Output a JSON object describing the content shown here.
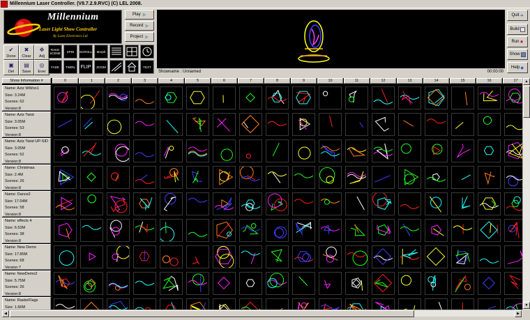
{
  "window": {
    "title": "Millennium Laser Controller. (V8.7.2.9.RVC) (C) LEL 2008."
  },
  "logo": {
    "brand": "Millennium",
    "subtitle": "Laser Light Show Controller",
    "byline": "By Laser Electronics Ltd"
  },
  "transport": {
    "play": "Play",
    "record": "Record",
    "project": "Project"
  },
  "tools": {
    "done": "Done",
    "clear": "Clear",
    "adj": "Adj",
    "del": "Del",
    "save": "Save",
    "ever": "Ever"
  },
  "effects": {
    "rake_scene": "RAKE SCENE",
    "spin": "SPIN",
    "scroll": "SCROLL",
    "morph": "Morph",
    "fade": "FADE",
    "twirl": "TWIRL",
    "flip": "FLIP",
    "zoom": "ZOOM",
    "text": "TEXT"
  },
  "preview": {
    "showname": "Showname : Unnamed",
    "time": "00:00:00"
  },
  "side": {
    "quit": "Quit",
    "build": "Build",
    "run": "Run",
    "show": "Show",
    "help": "Help"
  },
  "grid": {
    "header_label": "Show Information #",
    "columns": [
      "0",
      "1",
      "2",
      "3",
      "4",
      "5",
      "6",
      "7",
      "8",
      "9",
      "10",
      "11",
      "12",
      "13",
      "14",
      "15",
      "16",
      "17"
    ],
    "shows": [
      {
        "name": "Name:  Aziz WWoo1",
        "size": "Size: 3.24M",
        "scenes": "Scenes: 62",
        "version": "Version:8"
      },
      {
        "name": "Name:  Aziz Twist",
        "size": "Size: 3.05M",
        "scenes": "Scenes: 53",
        "version": "Version:8"
      },
      {
        "name": "Name:  Aziz Twist UP-SID",
        "size": "Size: 3.05M",
        "scenes": "Scenes: 52",
        "version": "Version:8"
      },
      {
        "name": "Name:  Christmas",
        "size": "Size: 2.4M",
        "scenes": "Scenes: 26",
        "version": "Version:8"
      },
      {
        "name": "Name:  Dance2",
        "size": "Size: 17.04M",
        "scenes": "Scenes: 58",
        "version": "Version:8"
      },
      {
        "name": "Name:  effects 4",
        "size": "Size: 6.53M",
        "scenes": "Scenes: 38",
        "version": "Version:8"
      },
      {
        "name": "Name:  New Demo",
        "size": "Size: 17.85M",
        "scenes": "Scenes: 68",
        "version": "Version:7"
      },
      {
        "name": "Name:  NewDemo2",
        "size": "Size: 5.75M",
        "scenes": "Scenes: 26",
        "version": "Version:8"
      },
      {
        "name": "Name:  RasterFlags",
        "size": "Size: 1.66M",
        "scenes": "",
        "version": ""
      }
    ]
  },
  "palette": [
    "#ff2020",
    "#20ff20",
    "#4040ff",
    "#ffff20",
    "#ff20ff",
    "#20ffff",
    "#ffffff",
    "#ff8020"
  ]
}
